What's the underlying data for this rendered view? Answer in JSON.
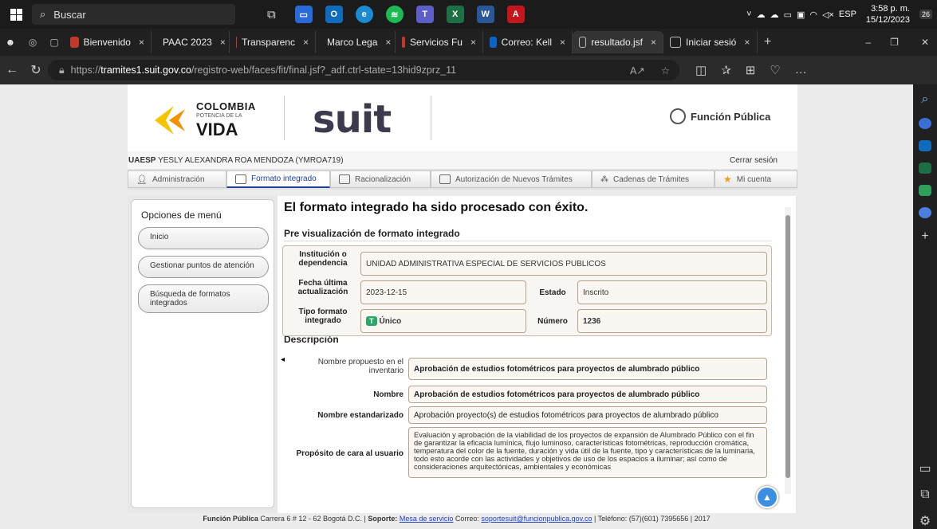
{
  "taskbar": {
    "search_placeholder": "Buscar",
    "language": "ESP",
    "time": "3:58 p. m.",
    "date": "15/12/2023",
    "badge_count": "26"
  },
  "tabs": [
    {
      "label": "Bienvenido",
      "color": "#c0392b"
    },
    {
      "label": "PAAC 2023",
      "color": "#2e9e5b"
    },
    {
      "label": "Transparenc",
      "color": "#c0392b"
    },
    {
      "label": "Marco Lega",
      "color": "#c0392b"
    },
    {
      "label": "Servicios Fu",
      "color": "#c0392b"
    },
    {
      "label": "Correo: Kell",
      "color": "#0a64c8"
    },
    {
      "label": "resultado.jsf",
      "color": "#777777"
    },
    {
      "label": "Iniciar sesió",
      "color": "#777777"
    }
  ],
  "address": {
    "prefix": "https://",
    "host": "tramites1.suit.gov.co",
    "path": "/registro-web/faces/fit/final.jsf?_adf.ctrl-state=13hid9zprz_11"
  },
  "header": {
    "col_line1": "COLOMBIA",
    "col_line2": "POTENCIA DE LA",
    "col_line3": "VIDA",
    "suit": "suit",
    "fp": "Función Pública"
  },
  "user": {
    "prefix": "UAESP",
    "name": "YESLY ALEXANDRA ROA MENDOZA (YMROA719)",
    "logout": "Cerrar sesión"
  },
  "menu": [
    {
      "label": "Administración"
    },
    {
      "label": "Formato integrado"
    },
    {
      "label": "Racionalización"
    },
    {
      "label": "Autorización de Nuevos Trámites"
    },
    {
      "label": "Cadenas de Trámites"
    },
    {
      "label": "Mi cuenta"
    }
  ],
  "left": {
    "title": "Opciones de menú",
    "items": [
      "Inicio",
      "Gestionar puntos de atención",
      "Búsqueda de formatos integrados"
    ]
  },
  "main": {
    "success": "El formato integrado ha sido procesado con éxito.",
    "preview_title": "Pre visualización de formato integrado",
    "institucion_label": "Institución o dependencia",
    "institucion": "UNIDAD ADMINISTRATIVA ESPECIAL DE SERVICIOS PUBLICOS",
    "fecha_label": "Fecha última actualización",
    "fecha": "2023-12-15",
    "estado_label": "Estado",
    "estado": "Inscrito",
    "tipo_label": "Tipo formato integrado",
    "tipo_badge": "T",
    "tipo": "Único",
    "numero_label": "Número",
    "numero": "1236",
    "descripcion_title": "Descripción",
    "nombre_prop_label": "Nombre propuesto en el inventario",
    "nombre_prop": "Aprobación de estudios fotométricos para proyectos de alumbrado público",
    "nombre_label": "Nombre",
    "nombre": "Aprobación de estudios fotométricos para proyectos de alumbrado público",
    "nombre_std_label": "Nombre estandarizado",
    "nombre_std": "Aprobación  proyecto(s)  de estudios fotométricos para proyectos de alumbrado público",
    "proposito_label": "Propósito de cara al usuario",
    "proposito": "Evaluación y aprobación de la viabilidad de los proyectos de expansión de Alumbrado Público con el fin de garantizar la eficacia lumínica, flujo luminoso, características fotométricas, reproducción cromática, temperatura del color de la fuente, duración y vida útil de la fuente, tipo y características de la luminaria, todo esto acorde con las actividades y objetivos de uso de los espacios a iluminar; así como de consideraciones arquitectónicas, ambientales y económicas"
  },
  "footer": {
    "brand": "Función Pública",
    "address": "Carrera 6 # 12 - 62 Bogotá D.C. |",
    "soporte_label": "Soporte:",
    "mesa": "Mesa de servicio",
    "correo_label": "Correo:",
    "correo": "soportesuit@funcionpublica.gov.co",
    "tel": "| Teléfono: (57)(601) 7395656 | 2017"
  },
  "colors": {
    "accent_blue": "#1f3f9a",
    "badge_green": "#29a86a",
    "box_border": "#b8a18a"
  }
}
